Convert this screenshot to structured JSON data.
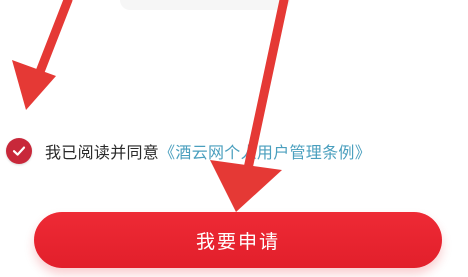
{
  "agreement": {
    "prefix": "我已阅读并同意",
    "link": "《酒云网个人用户管理条例》",
    "checked": true
  },
  "apply_button": {
    "label": "我要申请"
  },
  "colors": {
    "brand_red": "#e21f2b",
    "checkbox_red": "#c8283a",
    "link": "#4a9fbe",
    "annotation_arrow": "#e53935"
  },
  "icons": {
    "checkbox": "checkmark-icon",
    "annotations": "arrow-annotation-icon"
  }
}
